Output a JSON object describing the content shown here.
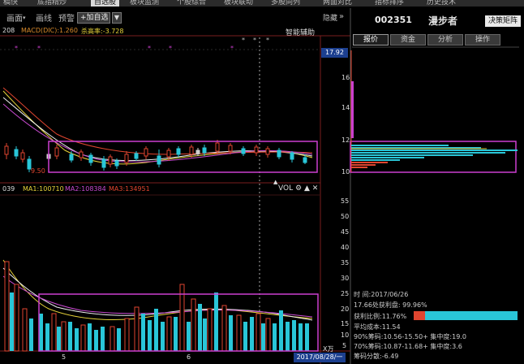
{
  "top_tabs": [
    "稿快",
    "底指精炒",
    "自选股",
    "板块监测",
    "个股综合",
    "板块联动",
    "多股同列",
    "两面对比",
    "指标排序",
    "历史技术"
  ],
  "toolbar": {
    "items": [
      "画面",
      "画线",
      "预警"
    ],
    "add_watch": "+加自选",
    "dropdown": "▼",
    "hide": "隐藏",
    "collapse": "»"
  },
  "indicator_line": {
    "prefix": "208",
    "indicator": "MACD(DIC):1.260",
    "ratio": "杀高率:-3.728"
  },
  "assist_label": "智能辅助",
  "stock": {
    "code": "002351",
    "name": "漫步者",
    "decision_button": "决策矩阵"
  },
  "side_tabs": [
    "报价",
    "资金",
    "分析",
    "操作"
  ],
  "price_axis": {
    "current": "17.92",
    "labels": [
      "16",
      "14",
      "12",
      "10"
    ],
    "low_label": "9.50"
  },
  "volume_line": {
    "prefix": "039",
    "ma1": "MA1:100710",
    "ma2": "MA2:108384",
    "ma3": "MA3:134951"
  },
  "volume_tools": {
    "vol": "VOL",
    "gear": "⚙",
    "up": "▲",
    "close": "✕"
  },
  "volume_axis": {
    "labels": [
      "55",
      "50",
      "45",
      "40",
      "35",
      "30",
      "25",
      "20",
      "15",
      "10",
      "5"
    ],
    "unit": "X万"
  },
  "x_axis": {
    "labels": [
      "5",
      "6"
    ],
    "date_marker": "2017/08/28/一"
  },
  "chip_stats": {
    "time": "时      间:2017/06/26",
    "profit_line": "17.66处获利盘: 99.96%",
    "profit_ratio": "获利比例:11.76%",
    "avg_cost": "平均成本:11.54",
    "chip90": "90%筹码:10.56-15.50+ 集中度:19.0",
    "chip70": "70%筹码:10.87-11.68+ 集中度:3.6",
    "concentration": "筹码分散:-6.49"
  },
  "colors": {
    "up": "#e0452f",
    "down": "#29c6d8",
    "highlight": "#cc3fcf",
    "ma_yellow": "#e6d23a",
    "ma_white": "#f0f0f0",
    "ma_magenta": "#c84ad0",
    "accent_blue": "#1c3f8f"
  }
}
